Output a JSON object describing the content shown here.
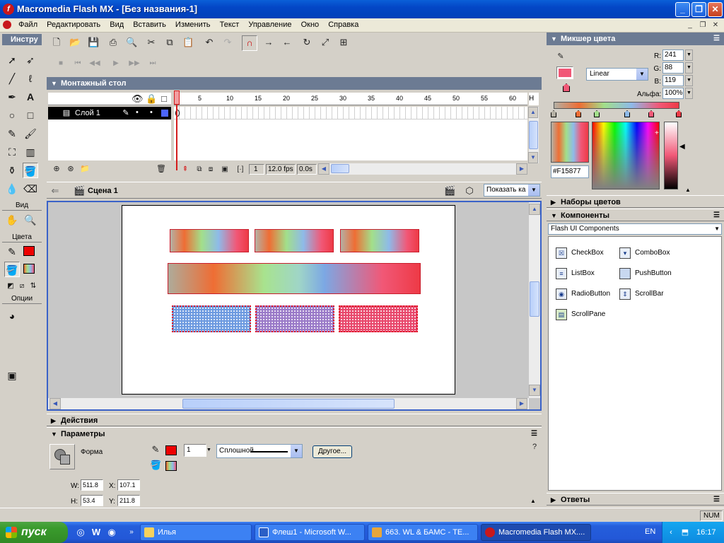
{
  "window": {
    "title": "Macromedia Flash MX - [Без названия-1]"
  },
  "menu": [
    "Файл",
    "Редактировать",
    "Вид",
    "Вставить",
    "Изменить",
    "Текст",
    "Управление",
    "Окно",
    "Справка"
  ],
  "tools": {
    "title": "Инстру",
    "view_label": "Вид",
    "colors_label": "Цвета",
    "options_label": "Опции",
    "stroke_color": "#ee0000",
    "fill_color": "#f15877"
  },
  "timeline": {
    "panel_title": "Монтажный стол",
    "ruler": [
      "1",
      "5",
      "10",
      "15",
      "20",
      "25",
      "30",
      "35",
      "40",
      "45",
      "50",
      "55",
      "60"
    ],
    "ruler_tail": "H",
    "layer_name": "Слой 1",
    "current_frame": "1",
    "fps": "12.0 fps",
    "time": "0.0s"
  },
  "scene": {
    "name": "Сцена 1",
    "zoom": "Показать ка"
  },
  "actions_panel": {
    "title": "Действия"
  },
  "properties": {
    "title": "Параметры",
    "shape_label": "Форма",
    "stroke_width": "1",
    "stroke_style": "Сплошной",
    "other_button": "Другое...",
    "w_label": "W:",
    "w": "511.8",
    "h_label": "H:",
    "h": "53.4",
    "x_label": "X:",
    "x": "107.1",
    "y_label": "Y:",
    "y": "211.8",
    "stroke_color": "#ee0000"
  },
  "color_mixer": {
    "title": "Микшер цвета",
    "fill_type": "Linear",
    "r_label": "R:",
    "r": "241",
    "g_label": "G:",
    "g": "88",
    "b_label": "B:",
    "b": "119",
    "alpha_label": "Альфа:",
    "alpha": "100%",
    "hex": "#F15877",
    "swatch_color": "#f15877"
  },
  "color_swatches_panel": {
    "title": "Наборы цветов"
  },
  "components_panel": {
    "title": "Компоненты",
    "set": "Flash UI Components",
    "items": [
      "CheckBox",
      "ComboBox",
      "ListBox",
      "PushButton",
      "RadioButton",
      "ScrollBar",
      "ScrollPane"
    ]
  },
  "answers_panel": {
    "title": "Ответы"
  },
  "status": {
    "num": "NUM"
  },
  "taskbar": {
    "start": "пуск",
    "tasks": [
      "Илья",
      "Флеш1 - Microsoft W...",
      "663. WL & БАМС - TE...",
      "Macromedia Flash MX...."
    ],
    "lang": "EN",
    "clock": "16:17"
  }
}
